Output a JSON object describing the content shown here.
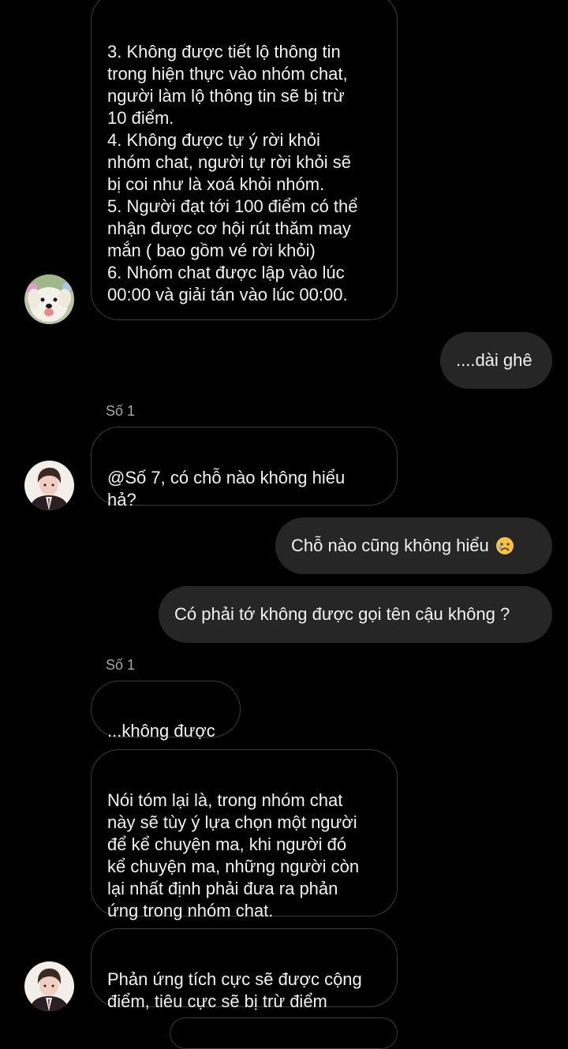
{
  "colors": {
    "background": "#000000",
    "outgoing_bubble": "#262626",
    "incoming_border": "#3a3a3a",
    "sender_name": "#a8a8a8"
  },
  "messages": [
    {
      "direction": "incoming",
      "avatar": "dog-avatar",
      "text": "3. Không được tiết lộ thông tin\ntrong hiện thực vào nhóm chat,\nngười làm lộ thông tin sẽ bị trừ\n10 điểm.\n4. Không được tự ý rời khỏi\nnhóm chat, người tự rời khỏi sẽ\nbị coi như là xoá khỏi nhóm.\n5. Người đạt tới 100 điểm có thể\nnhận được cơ hội rút thăm may\nmắn ( bao gồm vé rời khỏi)\n6. Nhóm chat được lập vào lúc\n00:00 và giải tán vào lúc 00:00."
    },
    {
      "direction": "outgoing",
      "text": "....dài ghê"
    },
    {
      "direction": "incoming",
      "sender": "Số 1",
      "avatar": "boy-avatar",
      "text": "@Số 7, có chỗ nào không hiểu\nhả?"
    },
    {
      "direction": "outgoing",
      "text": "Chỗ nào cũng không hiểu",
      "emoji": "sad-face-emoji"
    },
    {
      "direction": "outgoing",
      "text": "Có phải tớ không được gọi tên cậu không ?"
    },
    {
      "direction": "incoming",
      "sender": "Số 1",
      "text": "...không được"
    },
    {
      "direction": "incoming",
      "text": "Nói tóm lại là, trong nhóm chat\nnày sẽ tùy ý lựa chọn một người\nđể kể chuyện ma, khi người đó\nkể chuyện ma, những người còn\nlại nhất định phải đưa ra phản\nứng trong nhóm chat."
    },
    {
      "direction": "incoming",
      "avatar": "boy-avatar",
      "text": "Phản ứng tích cực sẽ được cộng\nđiểm, tiêu cực sẽ bị trừ điểm"
    }
  ]
}
